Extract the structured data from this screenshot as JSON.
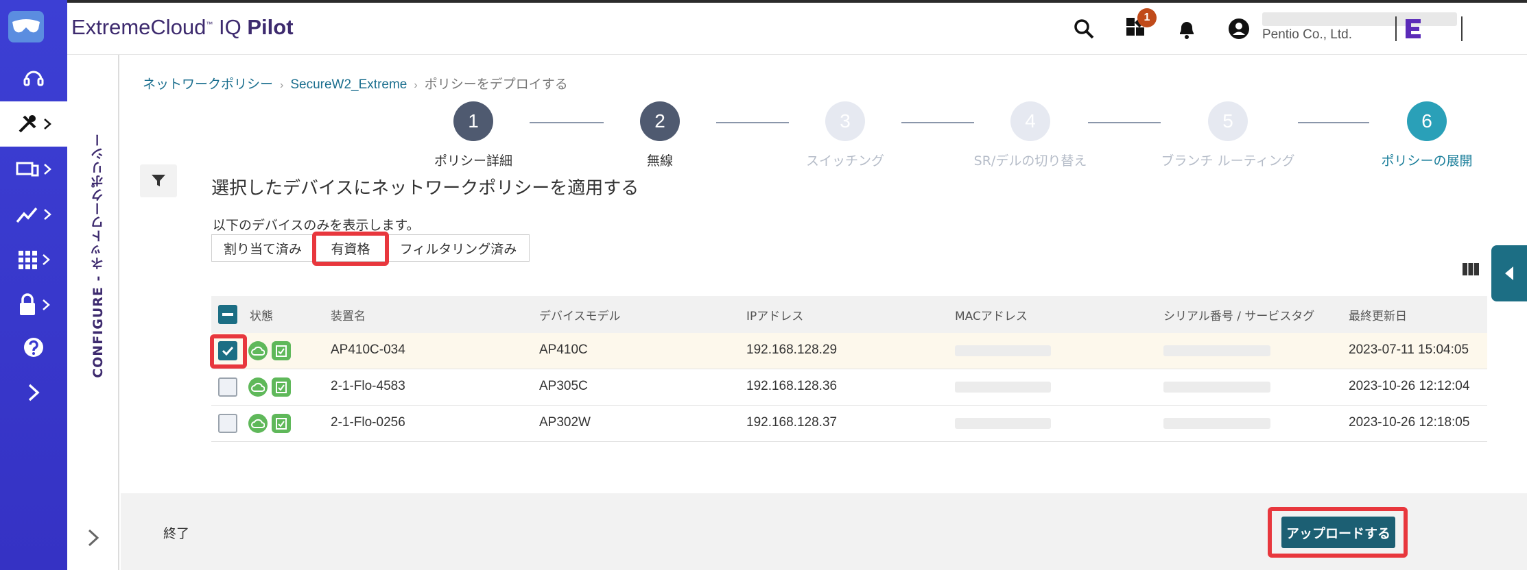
{
  "header": {
    "brand_main": "ExtremeCloud",
    "brand_tm": "™",
    "brand_iq": " IQ ",
    "brand_pilot": "Pilot",
    "notification_count": "1",
    "org_name": "Pentio Co., Ltd."
  },
  "secondary_panel": {
    "title": "CONFIGURE - ネットワークポリシー"
  },
  "breadcrumb": {
    "items": [
      "ネットワークポリシー",
      "SecureW2_Extreme",
      "ポリシーをデプロイする"
    ]
  },
  "steps": [
    {
      "num": "1",
      "label": "ポリシー詳細"
    },
    {
      "num": "2",
      "label": "無線"
    },
    {
      "num": "3",
      "label": "スイッチング"
    },
    {
      "num": "4",
      "label": "SR/デルの切り替え"
    },
    {
      "num": "5",
      "label": "ブランチ ルーティング"
    },
    {
      "num": "6",
      "label": "ポリシーの展開"
    }
  ],
  "colors": {
    "step_done": "#4f5a70",
    "step_pending": "#e6e9f1",
    "step_active": "#2aa0b8",
    "accent": "#1c6e84",
    "highlight": "#e8373d"
  },
  "main": {
    "title": "選択したデバイスにネットワークポリシーを適用する",
    "show_only": "以下のデバイスのみを表示します。",
    "filters": [
      "割り当て済み",
      "有資格",
      "フィルタリング済み"
    ]
  },
  "table": {
    "columns": [
      "状態",
      "装置名",
      "デバイスモデル",
      "IPアドレス",
      "MACアドレス",
      "シリアル番号 / サービスタグ",
      "最終更新日"
    ],
    "rows": [
      {
        "name": "AP410C-034",
        "model": "AP410C",
        "ip": "192.168.128.29",
        "updated": "2023-07-11 15:04:05"
      },
      {
        "name": "2-1-Flo-4583",
        "model": "AP305C",
        "ip": "192.168.128.36",
        "updated": "2023-10-26 12:12:04"
      },
      {
        "name": "2-1-Flo-0256",
        "model": "AP302W",
        "ip": "192.168.128.37",
        "updated": "2023-10-26 12:18:05"
      }
    ]
  },
  "footer": {
    "exit": "終了",
    "upload": "アップロードする"
  }
}
